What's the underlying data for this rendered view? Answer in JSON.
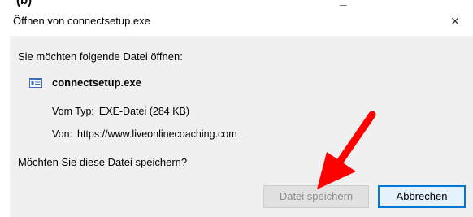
{
  "top_strip": {
    "fragment_left": "(b)",
    "fragment_right": "_"
  },
  "window": {
    "title": "Öffnen von connectsetup.exe",
    "close_glyph": "×"
  },
  "dialog": {
    "prompt": "Sie möchten folgende Datei öffnen:",
    "file_name": "connectsetup.exe",
    "file_icon": "exe-file-icon",
    "type_label": "Vom Typ:",
    "type_value": "EXE-Datei (284 KB)",
    "from_label": "Von:",
    "from_value": "https://www.liveonlinecoaching.com",
    "question": "Möchten Sie diese Datei speichern?"
  },
  "buttons": {
    "save": "Datei speichern",
    "cancel": "Abbrechen"
  },
  "annotation": {
    "arrow_color": "#ff0000"
  }
}
